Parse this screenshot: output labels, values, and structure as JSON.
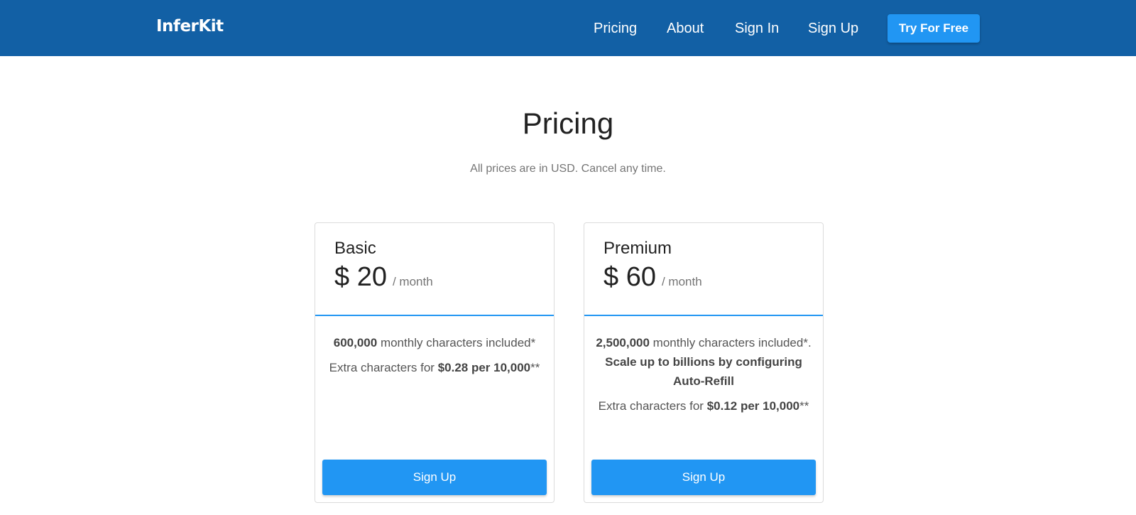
{
  "nav": {
    "brand": "InferKit",
    "links": [
      "Pricing",
      "About",
      "Sign In",
      "Sign Up"
    ],
    "cta": "Try For Free"
  },
  "header": {
    "title": "Pricing",
    "subtitle": "All prices are in USD. Cancel any time."
  },
  "plans": [
    {
      "name": "Basic",
      "price": "$ 20",
      "period": "/ month",
      "line1_bold": "600,000",
      "line1_text": " monthly characters included*",
      "line1_extra": "",
      "line2_text": "Extra characters for ",
      "line2_bold": "$0.28 per 10,000",
      "line2_suffix": "**",
      "button": "Sign Up"
    },
    {
      "name": "Premium",
      "price": "$ 60",
      "period": "/ month",
      "line1_bold": "2,500,000",
      "line1_text": " monthly characters included*. ",
      "line1_extra": "Scale up to billions by configuring Auto-Refill",
      "line2_text": "Extra characters for ",
      "line2_bold": "$0.12 per 10,000",
      "line2_suffix": "**",
      "button": "Sign Up"
    }
  ],
  "colors": {
    "nav_bg": "#1260a5",
    "accent": "#2196f3"
  }
}
